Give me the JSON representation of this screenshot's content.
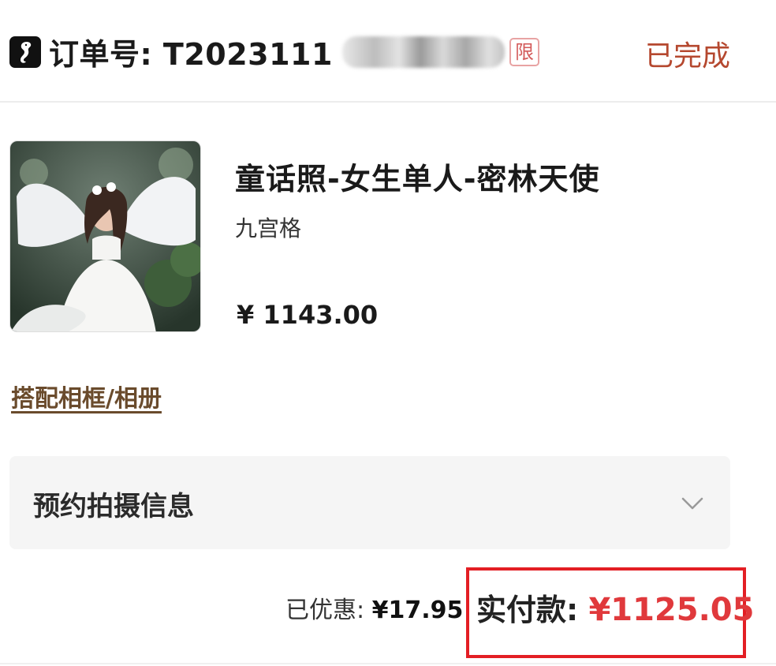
{
  "header": {
    "order_label": "订单号: T2023111",
    "limit_tag": "限",
    "status": "已完成"
  },
  "product": {
    "image": "angel-photo",
    "title": "童话照-女生单人-密林天使",
    "spec": "九宫格",
    "price": "¥ 1143.00"
  },
  "addon_link": "搭配相框/相册",
  "booking": {
    "label": "预约拍摄信息"
  },
  "summary": {
    "discount_label": "已优惠:",
    "discount_value": "¥17.95",
    "paid_label": "实付款:",
    "paid_value": "¥1125.05"
  },
  "colors": {
    "status": "#b5482f",
    "paid_value": "#e0393c",
    "highlight_box": "#e31e24",
    "addon_link": "#6a4b2c"
  }
}
